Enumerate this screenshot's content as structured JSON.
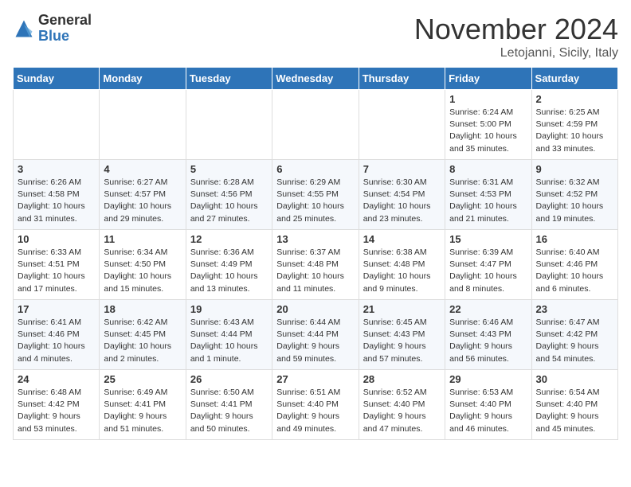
{
  "logo": {
    "general": "General",
    "blue": "Blue"
  },
  "title": "November 2024",
  "location": "Letojanni, Sicily, Italy",
  "days_of_week": [
    "Sunday",
    "Monday",
    "Tuesday",
    "Wednesday",
    "Thursday",
    "Friday",
    "Saturday"
  ],
  "weeks": [
    [
      {
        "day": "",
        "info": ""
      },
      {
        "day": "",
        "info": ""
      },
      {
        "day": "",
        "info": ""
      },
      {
        "day": "",
        "info": ""
      },
      {
        "day": "",
        "info": ""
      },
      {
        "day": "1",
        "info": "Sunrise: 6:24 AM\nSunset: 5:00 PM\nDaylight: 10 hours\nand 35 minutes."
      },
      {
        "day": "2",
        "info": "Sunrise: 6:25 AM\nSunset: 4:59 PM\nDaylight: 10 hours\nand 33 minutes."
      }
    ],
    [
      {
        "day": "3",
        "info": "Sunrise: 6:26 AM\nSunset: 4:58 PM\nDaylight: 10 hours\nand 31 minutes."
      },
      {
        "day": "4",
        "info": "Sunrise: 6:27 AM\nSunset: 4:57 PM\nDaylight: 10 hours\nand 29 minutes."
      },
      {
        "day": "5",
        "info": "Sunrise: 6:28 AM\nSunset: 4:56 PM\nDaylight: 10 hours\nand 27 minutes."
      },
      {
        "day": "6",
        "info": "Sunrise: 6:29 AM\nSunset: 4:55 PM\nDaylight: 10 hours\nand 25 minutes."
      },
      {
        "day": "7",
        "info": "Sunrise: 6:30 AM\nSunset: 4:54 PM\nDaylight: 10 hours\nand 23 minutes."
      },
      {
        "day": "8",
        "info": "Sunrise: 6:31 AM\nSunset: 4:53 PM\nDaylight: 10 hours\nand 21 minutes."
      },
      {
        "day": "9",
        "info": "Sunrise: 6:32 AM\nSunset: 4:52 PM\nDaylight: 10 hours\nand 19 minutes."
      }
    ],
    [
      {
        "day": "10",
        "info": "Sunrise: 6:33 AM\nSunset: 4:51 PM\nDaylight: 10 hours\nand 17 minutes."
      },
      {
        "day": "11",
        "info": "Sunrise: 6:34 AM\nSunset: 4:50 PM\nDaylight: 10 hours\nand 15 minutes."
      },
      {
        "day": "12",
        "info": "Sunrise: 6:36 AM\nSunset: 4:49 PM\nDaylight: 10 hours\nand 13 minutes."
      },
      {
        "day": "13",
        "info": "Sunrise: 6:37 AM\nSunset: 4:48 PM\nDaylight: 10 hours\nand 11 minutes."
      },
      {
        "day": "14",
        "info": "Sunrise: 6:38 AM\nSunset: 4:48 PM\nDaylight: 10 hours\nand 9 minutes."
      },
      {
        "day": "15",
        "info": "Sunrise: 6:39 AM\nSunset: 4:47 PM\nDaylight: 10 hours\nand 8 minutes."
      },
      {
        "day": "16",
        "info": "Sunrise: 6:40 AM\nSunset: 4:46 PM\nDaylight: 10 hours\nand 6 minutes."
      }
    ],
    [
      {
        "day": "17",
        "info": "Sunrise: 6:41 AM\nSunset: 4:46 PM\nDaylight: 10 hours\nand 4 minutes."
      },
      {
        "day": "18",
        "info": "Sunrise: 6:42 AM\nSunset: 4:45 PM\nDaylight: 10 hours\nand 2 minutes."
      },
      {
        "day": "19",
        "info": "Sunrise: 6:43 AM\nSunset: 4:44 PM\nDaylight: 10 hours\nand 1 minute."
      },
      {
        "day": "20",
        "info": "Sunrise: 6:44 AM\nSunset: 4:44 PM\nDaylight: 9 hours\nand 59 minutes."
      },
      {
        "day": "21",
        "info": "Sunrise: 6:45 AM\nSunset: 4:43 PM\nDaylight: 9 hours\nand 57 minutes."
      },
      {
        "day": "22",
        "info": "Sunrise: 6:46 AM\nSunset: 4:43 PM\nDaylight: 9 hours\nand 56 minutes."
      },
      {
        "day": "23",
        "info": "Sunrise: 6:47 AM\nSunset: 4:42 PM\nDaylight: 9 hours\nand 54 minutes."
      }
    ],
    [
      {
        "day": "24",
        "info": "Sunrise: 6:48 AM\nSunset: 4:42 PM\nDaylight: 9 hours\nand 53 minutes."
      },
      {
        "day": "25",
        "info": "Sunrise: 6:49 AM\nSunset: 4:41 PM\nDaylight: 9 hours\nand 51 minutes."
      },
      {
        "day": "26",
        "info": "Sunrise: 6:50 AM\nSunset: 4:41 PM\nDaylight: 9 hours\nand 50 minutes."
      },
      {
        "day": "27",
        "info": "Sunrise: 6:51 AM\nSunset: 4:40 PM\nDaylight: 9 hours\nand 49 minutes."
      },
      {
        "day": "28",
        "info": "Sunrise: 6:52 AM\nSunset: 4:40 PM\nDaylight: 9 hours\nand 47 minutes."
      },
      {
        "day": "29",
        "info": "Sunrise: 6:53 AM\nSunset: 4:40 PM\nDaylight: 9 hours\nand 46 minutes."
      },
      {
        "day": "30",
        "info": "Sunrise: 6:54 AM\nSunset: 4:40 PM\nDaylight: 9 hours\nand 45 minutes."
      }
    ]
  ]
}
